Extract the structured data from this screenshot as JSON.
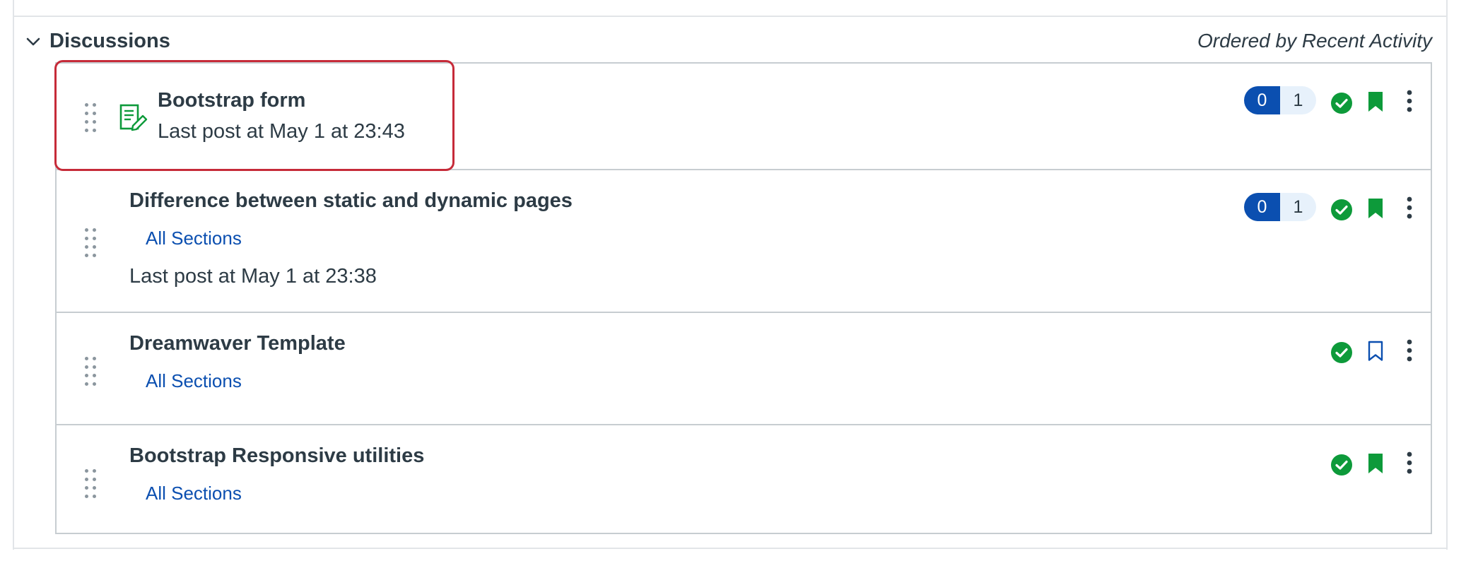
{
  "section": {
    "title": "Discussions",
    "order_label": "Ordered by Recent Activity"
  },
  "discussions": [
    {
      "title": "Bootstrap form",
      "last_post": "Last post at May 1 at 23:43",
      "unread_count": "0",
      "total_count": "1",
      "published": true,
      "subscribed": true,
      "icon": "discussion-edit-icon"
    },
    {
      "title": "Difference between static and dynamic pages",
      "sections": "All Sections",
      "last_post": "Last post at May 1 at 23:38",
      "unread_count": "0",
      "total_count": "1",
      "published": true,
      "subscribed": true
    },
    {
      "title": "Dreamwaver Template",
      "sections": "All Sections",
      "published": true,
      "subscribed": false
    },
    {
      "title": "Bootstrap Responsive utilities",
      "sections": "All Sections",
      "published": true,
      "subscribed": true
    }
  ],
  "colors": {
    "published": "#0d9a3a",
    "subscribed": "#0d9a3a",
    "unsubscribed": "#0b4fb0",
    "badge_unread_bg": "#0b4fb0",
    "badge_total_bg": "#e7f1fb",
    "link": "#0b4fb0",
    "focus_outline": "#c62b39"
  }
}
